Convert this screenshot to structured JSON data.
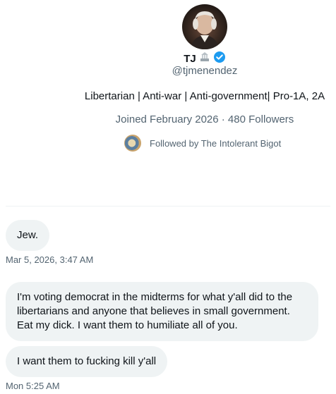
{
  "profile": {
    "name": "TJ",
    "handle": "@tjmenendez",
    "bio": "Libertarian | Anti-war | Anti-government| Pro-1A, 2A",
    "meta": "Joined February 2026 · 480 Followers",
    "followed_by": "Followed by The Intolerant Bigot",
    "verified_color": "#1d9bf0"
  },
  "messages": [
    {
      "text": "Jew.",
      "timestamp": "Mar 5, 2026, 3:47 AM"
    },
    {
      "text": "I'm voting democrat in the midterms for what y'all did to the libertarians and anyone that believes in small government. Eat my dick. I want them to humiliate all of you."
    },
    {
      "text": "I want them to fucking kill y'all",
      "timestamp": "Mon 5:25 AM"
    }
  ]
}
